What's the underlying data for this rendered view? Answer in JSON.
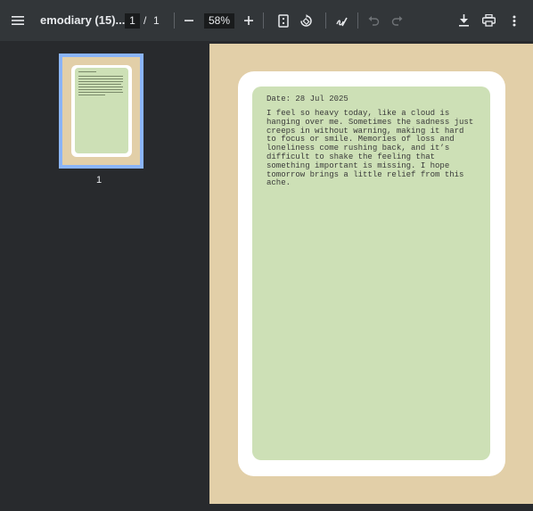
{
  "toolbar": {
    "title": "emodiary (15)...",
    "page_current": "1",
    "page_separator": "/",
    "page_total": "1",
    "zoom": "58%"
  },
  "sidebar": {
    "thumbnail_label": "1"
  },
  "document": {
    "date": "Date: 28 Jul 2025",
    "body": "I feel so heavy today, like a cloud is hanging over me. Sometimes the sadness just creeps in without warning, making it hard to focus or smile. Memories of loss and loneliness come rushing back, and it’s difficult to shake the feeling that something important is missing. I hope tomorrow brings a little relief from this ache."
  },
  "colors": {
    "toolbar_bg": "#323639",
    "viewer_bg": "#282a2d",
    "page_bg": "#e2cfa8",
    "card_bg": "#cde0b6",
    "thumb_highlight": "#8ab4f8"
  },
  "icons": [
    "menu-icon",
    "zoom-out-icon",
    "zoom-in-icon",
    "fit-page-icon",
    "rotate-icon",
    "annotate-icon",
    "undo-icon",
    "redo-icon",
    "download-icon",
    "print-icon",
    "more-options-icon"
  ]
}
